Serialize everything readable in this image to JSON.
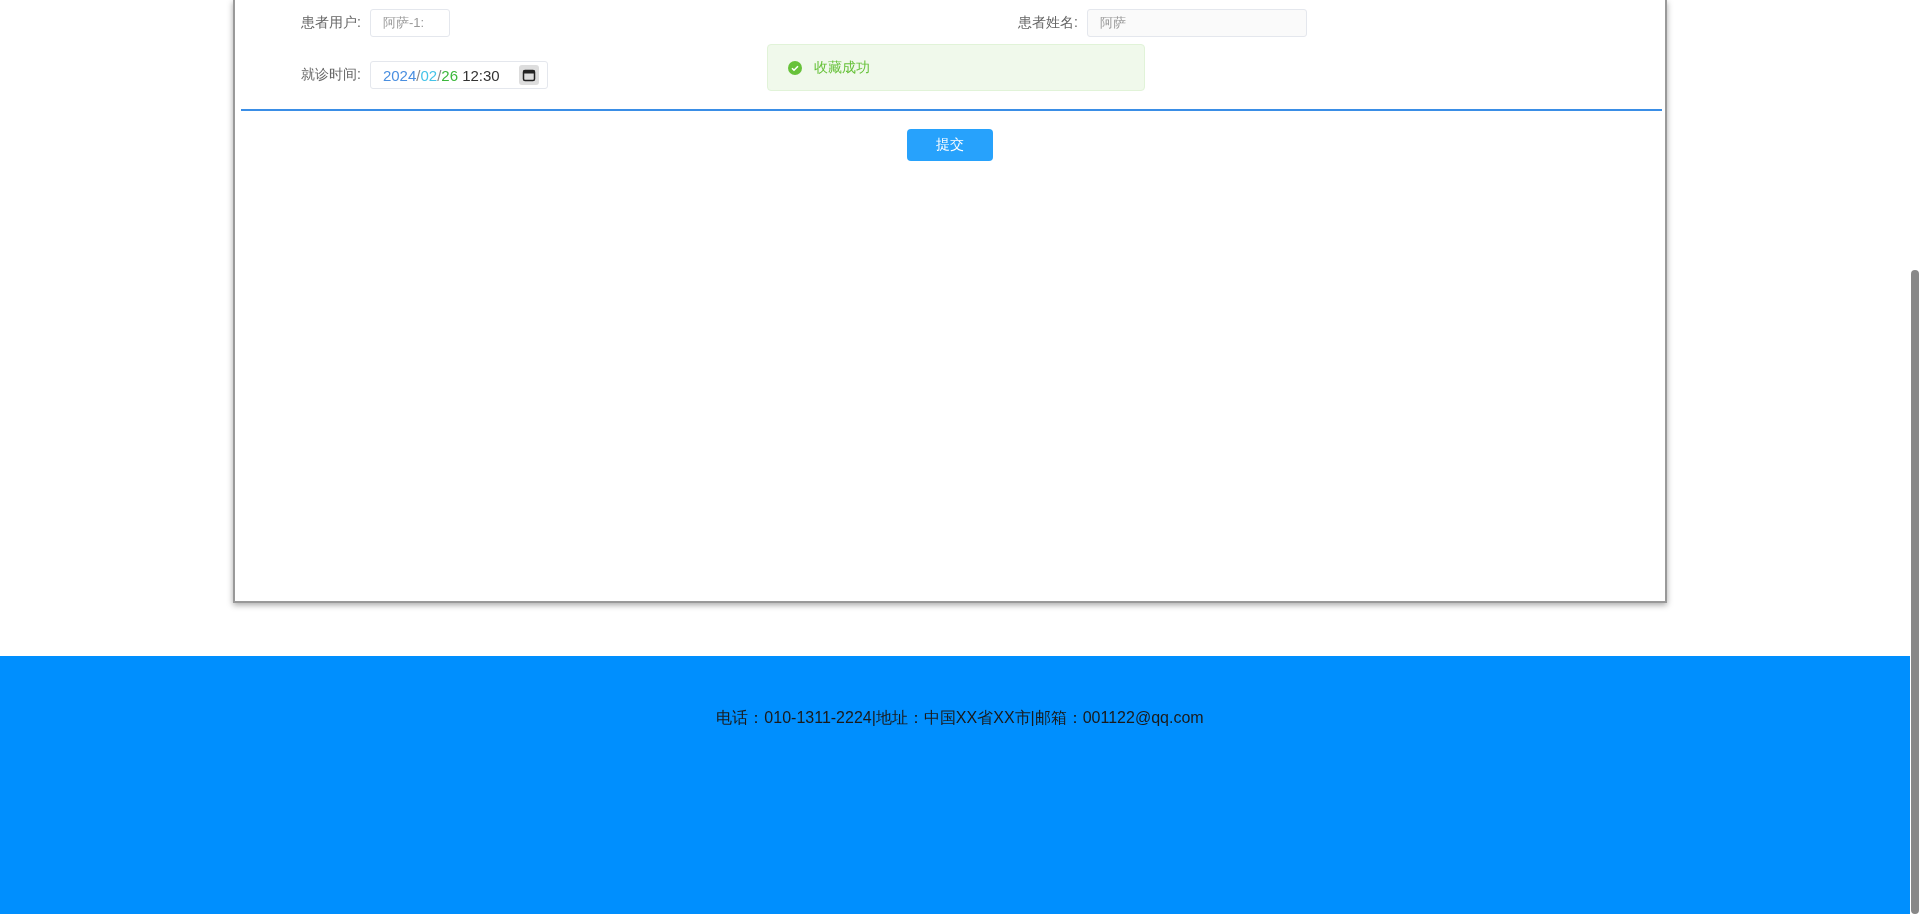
{
  "form": {
    "fields": [
      {
        "label": "患者用户:",
        "value": "阿萨-1:",
        "kind": "text"
      },
      {
        "label": "患者姓名:",
        "value": "阿萨",
        "kind": "wide"
      }
    ],
    "visit_time": {
      "label": "就诊时间:",
      "parts": [
        {
          "text": "2024",
          "color": "#4a8fe0"
        },
        {
          "text": "/",
          "color": "#888888"
        },
        {
          "text": "02",
          "color": "#45c3e8"
        },
        {
          "text": "/",
          "color": "#888888"
        },
        {
          "text": "26",
          "color": "#3cb83c"
        },
        {
          "text": " 12:30",
          "color": "#333333"
        }
      ]
    },
    "submit": "提交"
  },
  "toast": {
    "kind": "success",
    "message": "收藏成功"
  },
  "footer": {
    "text": "电话：010-1311-2224|地址：中国XX省XX市|邮箱：001122@qq.com"
  }
}
